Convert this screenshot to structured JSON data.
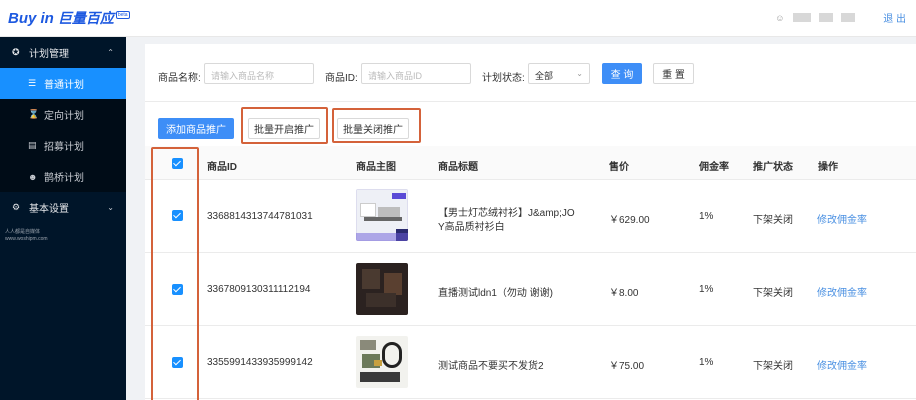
{
  "header": {
    "logo_text": "Buy in",
    "logo_cn": "巨量百应",
    "logo_badge": "beta",
    "logout_label": "退 出"
  },
  "sidebar": {
    "group_plan": "计划管理",
    "items": [
      {
        "label": "普通计划",
        "icon": "list-icon",
        "active": true
      },
      {
        "label": "定向计划",
        "icon": "hourglass-icon",
        "active": false
      },
      {
        "label": "招募计划",
        "icon": "document-icon",
        "active": false
      },
      {
        "label": "鹊桥计划",
        "icon": "person-icon",
        "active": false
      }
    ],
    "group_settings": "基本设置",
    "note_line1": "人人都是自媒体",
    "note_line2": "www.woshipm.com"
  },
  "filters": {
    "name_label": "商品名称:",
    "name_placeholder": "请输入商品名称",
    "id_label": "商品ID:",
    "id_placeholder": "请输入商品ID",
    "status_label": "计划状态:",
    "status_value": "全部",
    "query_label": "查 询",
    "reset_label": "重 置"
  },
  "actions": {
    "add_label": "添加商品推广",
    "batch_on_label": "批量开启推广",
    "batch_off_label": "批量关闭推广"
  },
  "table": {
    "columns": [
      "商品ID",
      "商品主图",
      "商品标题",
      "售价",
      "佣金率",
      "推广状态",
      "操作"
    ],
    "rows": [
      {
        "id": "3368814313744781031",
        "title_line1": "【男士灯芯绒衬衫】J&amp;JO",
        "title_line2": "Y高品质衬衫白",
        "price": "￥629.00",
        "rate": "1%",
        "status": "下架关闭",
        "action": "修改佣金率"
      },
      {
        "id": "3367809130311112194",
        "title_line1": "直播测试ldn1（勿动 谢谢)",
        "title_line2": "",
        "price": "￥8.00",
        "rate": "1%",
        "status": "下架关闭",
        "action": "修改佣金率"
      },
      {
        "id": "3355991433935999142",
        "title_line1": "测试商品不要买不发货2",
        "title_line2": "",
        "price": "￥75.00",
        "rate": "1%",
        "status": "下架关闭",
        "action": "修改佣金率"
      }
    ]
  },
  "colors": {
    "accent": "#1890ff",
    "sidebar_bg": "#001529",
    "highlight": "#d4623a"
  }
}
